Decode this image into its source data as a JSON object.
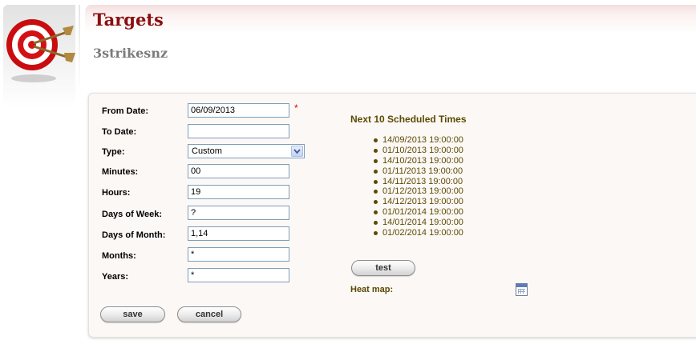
{
  "header": {
    "title": "Targets",
    "subtitle": "3strikesnz",
    "icon": "target-bullseye-icon"
  },
  "form": {
    "from_date_label": "From Date:",
    "from_date_value": "06/09/2013",
    "required_mark": "*",
    "to_date_label": "To Date:",
    "to_date_value": "",
    "type_label": "Type:",
    "type_value": "Custom",
    "minutes_label": "Minutes:",
    "minutes_value": "00",
    "hours_label": "Hours:",
    "hours_value": "19",
    "days_of_week_label": "Days of Week:",
    "days_of_week_value": "?",
    "days_of_month_label": "Days of Month:",
    "days_of_month_value": "1,14",
    "months_label": "Months:",
    "months_value": "*",
    "years_label": "Years:",
    "years_value": "*",
    "save_label": "save",
    "cancel_label": "cancel"
  },
  "schedule": {
    "title": "Next 10 Scheduled Times",
    "times": [
      "14/09/2013 19:00:00",
      "01/10/2013 19:00:00",
      "14/10/2013 19:00:00",
      "01/11/2013 19:00:00",
      "14/11/2013 19:00:00",
      "01/12/2013 19:00:00",
      "14/12/2013 19:00:00",
      "01/01/2014 19:00:00",
      "14/01/2014 19:00:00",
      "01/02/2014 19:00:00"
    ],
    "test_label": "test",
    "heat_map_label": "Heat map:"
  },
  "colors": {
    "title": "#8b0e0e",
    "subtitle": "#7b7b7b",
    "schedule_text": "#5c4a00",
    "required": "#d80000"
  }
}
